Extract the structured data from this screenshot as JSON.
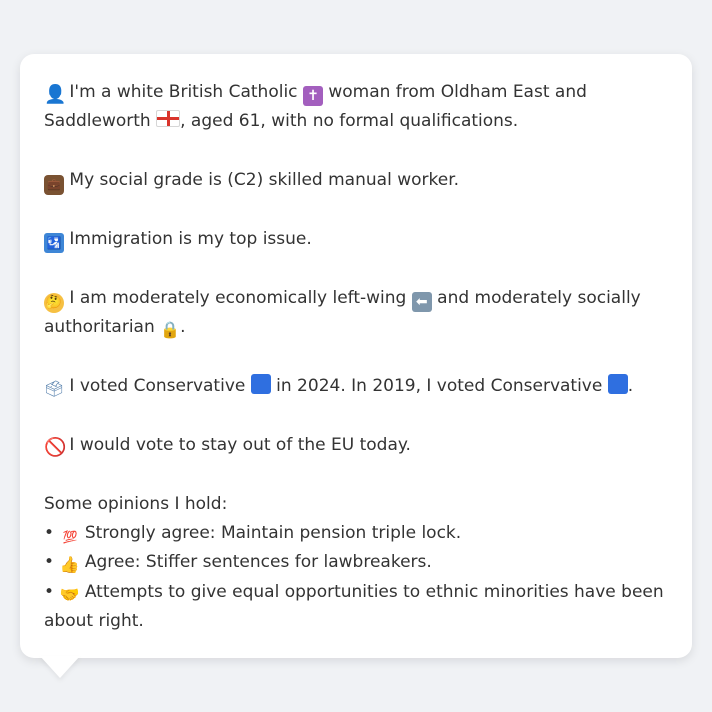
{
  "message": {
    "identity": {
      "part1": "I'm a white British Catholic",
      "part2": "woman from Oldham East and Saddleworth",
      "part3": ", aged 61, with no formal qualifications."
    },
    "social_grade": "My social grade is (C2) skilled manual worker.",
    "top_issue": "Immigration is my top issue.",
    "ideology": {
      "part1": "I am moderately economically left-wing",
      "part2": "and moderately socially authoritarian",
      "part3": "."
    },
    "vote_history": {
      "part1": "I voted Conservative",
      "part2": "in 2024. In 2019, I voted Conservative",
      "part3": "."
    },
    "eu_vote": "I would vote to stay out of the EU today.",
    "opinions_heading": "Some opinions I hold:",
    "bullet": "•",
    "opinions": [
      "Strongly agree: Maintain pension triple lock.",
      "Agree: Stiffer sentences for lawbreakers.",
      "Attempts to give equal opportunities to ethnic minorities have been about right."
    ]
  },
  "glyphs": {
    "person": "👤",
    "cross": "✝",
    "briefcase": "💼",
    "immigration": "🛂",
    "thinking": "🤔",
    "left_arrow": "⬅",
    "lock": "🔒",
    "ballot": "🗳",
    "no_entry": "🚫",
    "hundred": "💯",
    "thumbs_up": "👍",
    "handshake": "🤝"
  },
  "colors": {
    "text": "#333333",
    "background": "#f0f2f5",
    "bubble": "#ffffff",
    "conservative_blue": "#2f6fe0"
  }
}
